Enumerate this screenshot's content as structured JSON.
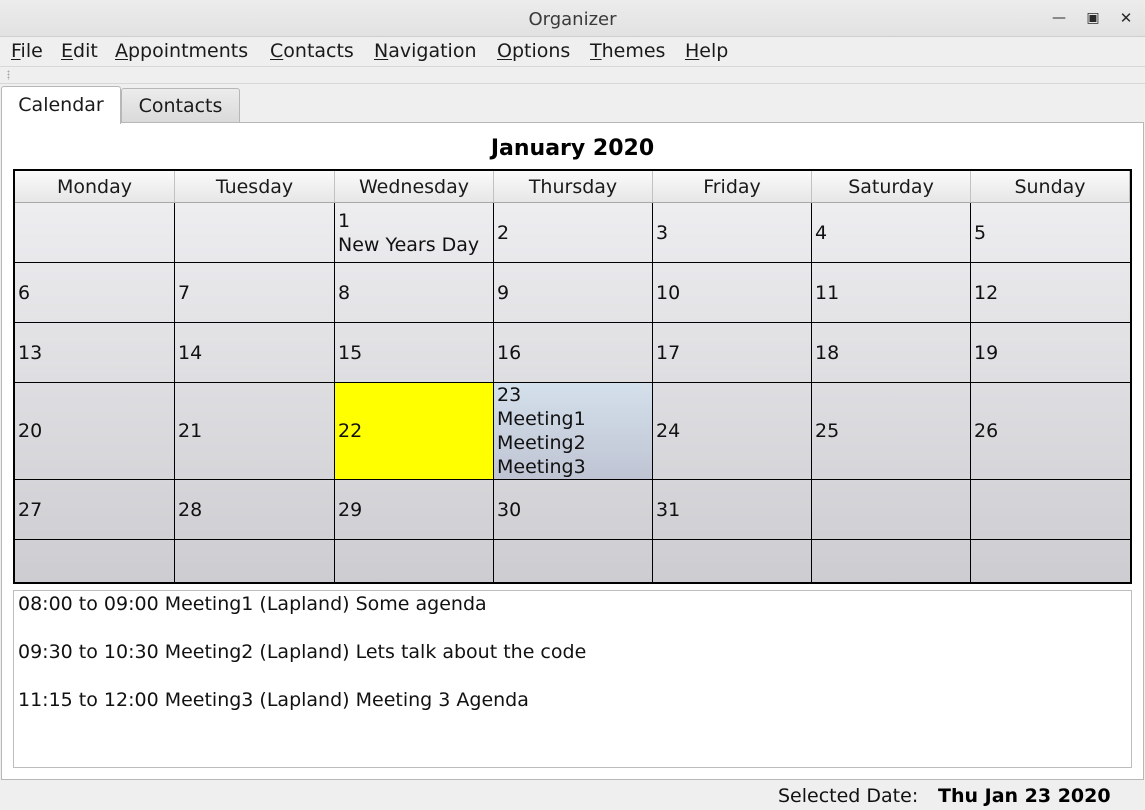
{
  "window": {
    "title": "Organizer"
  },
  "menu": [
    {
      "mnemonic": "F",
      "rest": "ile"
    },
    {
      "mnemonic": "E",
      "rest": "dit"
    },
    {
      "mnemonic": "A",
      "rest": "ppointments"
    },
    {
      "mnemonic": "C",
      "rest": "ontacts"
    },
    {
      "mnemonic": "N",
      "rest": "avigation"
    },
    {
      "mnemonic": "O",
      "rest": "ptions"
    },
    {
      "mnemonic": "T",
      "rest": "hemes"
    },
    {
      "mnemonic": "H",
      "rest": "elp"
    }
  ],
  "tabs": [
    "Calendar",
    "Contacts"
  ],
  "calendar": {
    "month_title": "January 2020",
    "weekdays": [
      "Monday",
      "Tuesday",
      "Wednesday",
      "Thursday",
      "Friday",
      "Saturday",
      "Sunday"
    ],
    "rows": [
      [
        {
          "lines": []
        },
        {
          "lines": []
        },
        {
          "lines": [
            "1",
            "New Years Day"
          ]
        },
        {
          "lines": [
            "2"
          ]
        },
        {
          "lines": [
            "3"
          ]
        },
        {
          "lines": [
            "4"
          ]
        },
        {
          "lines": [
            "5"
          ]
        }
      ],
      [
        {
          "lines": [
            "6"
          ]
        },
        {
          "lines": [
            "7"
          ]
        },
        {
          "lines": [
            "8"
          ]
        },
        {
          "lines": [
            "9"
          ]
        },
        {
          "lines": [
            "10"
          ]
        },
        {
          "lines": [
            "11"
          ]
        },
        {
          "lines": [
            "12"
          ]
        }
      ],
      [
        {
          "lines": [
            "13"
          ]
        },
        {
          "lines": [
            "14"
          ]
        },
        {
          "lines": [
            "15"
          ]
        },
        {
          "lines": [
            "16"
          ]
        },
        {
          "lines": [
            "17"
          ]
        },
        {
          "lines": [
            "18"
          ]
        },
        {
          "lines": [
            "19"
          ]
        }
      ],
      [
        {
          "lines": [
            "20"
          ]
        },
        {
          "lines": [
            "21"
          ]
        },
        {
          "lines": [
            "22"
          ],
          "state": "today"
        },
        {
          "lines": [
            "23",
            "Meeting1",
            "Meeting2",
            "Meeting3"
          ],
          "state": "selected"
        },
        {
          "lines": [
            "24"
          ]
        },
        {
          "lines": [
            "25"
          ]
        },
        {
          "lines": [
            "26"
          ]
        }
      ],
      [
        {
          "lines": [
            "27"
          ]
        },
        {
          "lines": [
            "28"
          ]
        },
        {
          "lines": [
            "29"
          ]
        },
        {
          "lines": [
            "30"
          ]
        },
        {
          "lines": [
            "31"
          ]
        },
        {
          "lines": []
        },
        {
          "lines": []
        }
      ],
      [
        {
          "lines": []
        },
        {
          "lines": []
        },
        {
          "lines": []
        },
        {
          "lines": []
        },
        {
          "lines": []
        },
        {
          "lines": []
        },
        {
          "lines": []
        }
      ]
    ],
    "colors": {
      "today": "#ffff00",
      "selected": "#c9d3e1"
    }
  },
  "appointments": [
    "08:00 to 09:00 Meeting1 (Lapland) Some agenda",
    "09:30 to 10:30 Meeting2 (Lapland) Lets talk about the code",
    "11:15 to 12:00 Meeting3 (Lapland) Meeting 3 Agenda"
  ],
  "status": {
    "label": "Selected Date:",
    "value": "Thu Jan 23 2020"
  }
}
